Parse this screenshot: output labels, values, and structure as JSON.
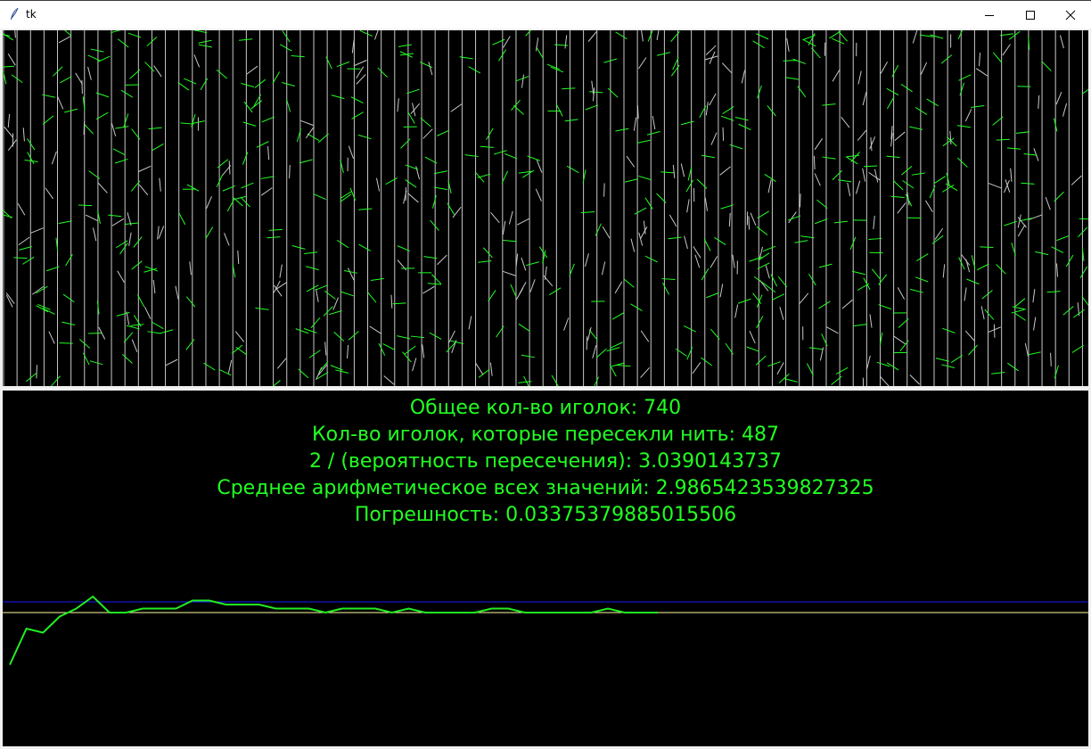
{
  "window": {
    "title": "tk"
  },
  "simulation": {
    "total_needles": 740,
    "line_count": 81,
    "needle_color": "#22ff22",
    "thread_color": "#c8c8c8"
  },
  "stats": {
    "total_label": "Общее кол-во иголок: 740",
    "crossed_label": "Кол-во иголок, которые пересекли нить: 487",
    "ratio_label": "2 / (вероятность пересечения): 3.0390143737",
    "mean_label": "Среднее арифметическое всех значений: 2.9865423539827325",
    "error_label": "Погрешность: 0.03375379885015506"
  },
  "chart_data": {
    "type": "line",
    "series": [
      {
        "values": [
          2.82,
          2.91,
          2.9,
          2.94,
          2.96,
          2.99,
          2.95,
          2.95,
          2.96,
          2.96,
          2.96,
          2.98,
          2.98,
          2.97,
          2.97,
          2.97,
          2.96,
          2.96,
          2.96,
          2.95,
          2.96,
          2.96,
          2.96,
          2.95,
          2.96,
          2.95,
          2.95,
          2.95,
          2.95,
          2.96,
          2.96,
          2.95,
          2.95,
          2.95,
          2.95,
          2.95,
          2.96,
          2.95,
          2.95,
          2.95
        ]
      }
    ],
    "reference_pi": 3.14159,
    "reference_current": 3.0390143737,
    "colors": {
      "line": "#22ee22",
      "pi_line": "#1a1aff",
      "current_line": "#ffffa0"
    }
  }
}
